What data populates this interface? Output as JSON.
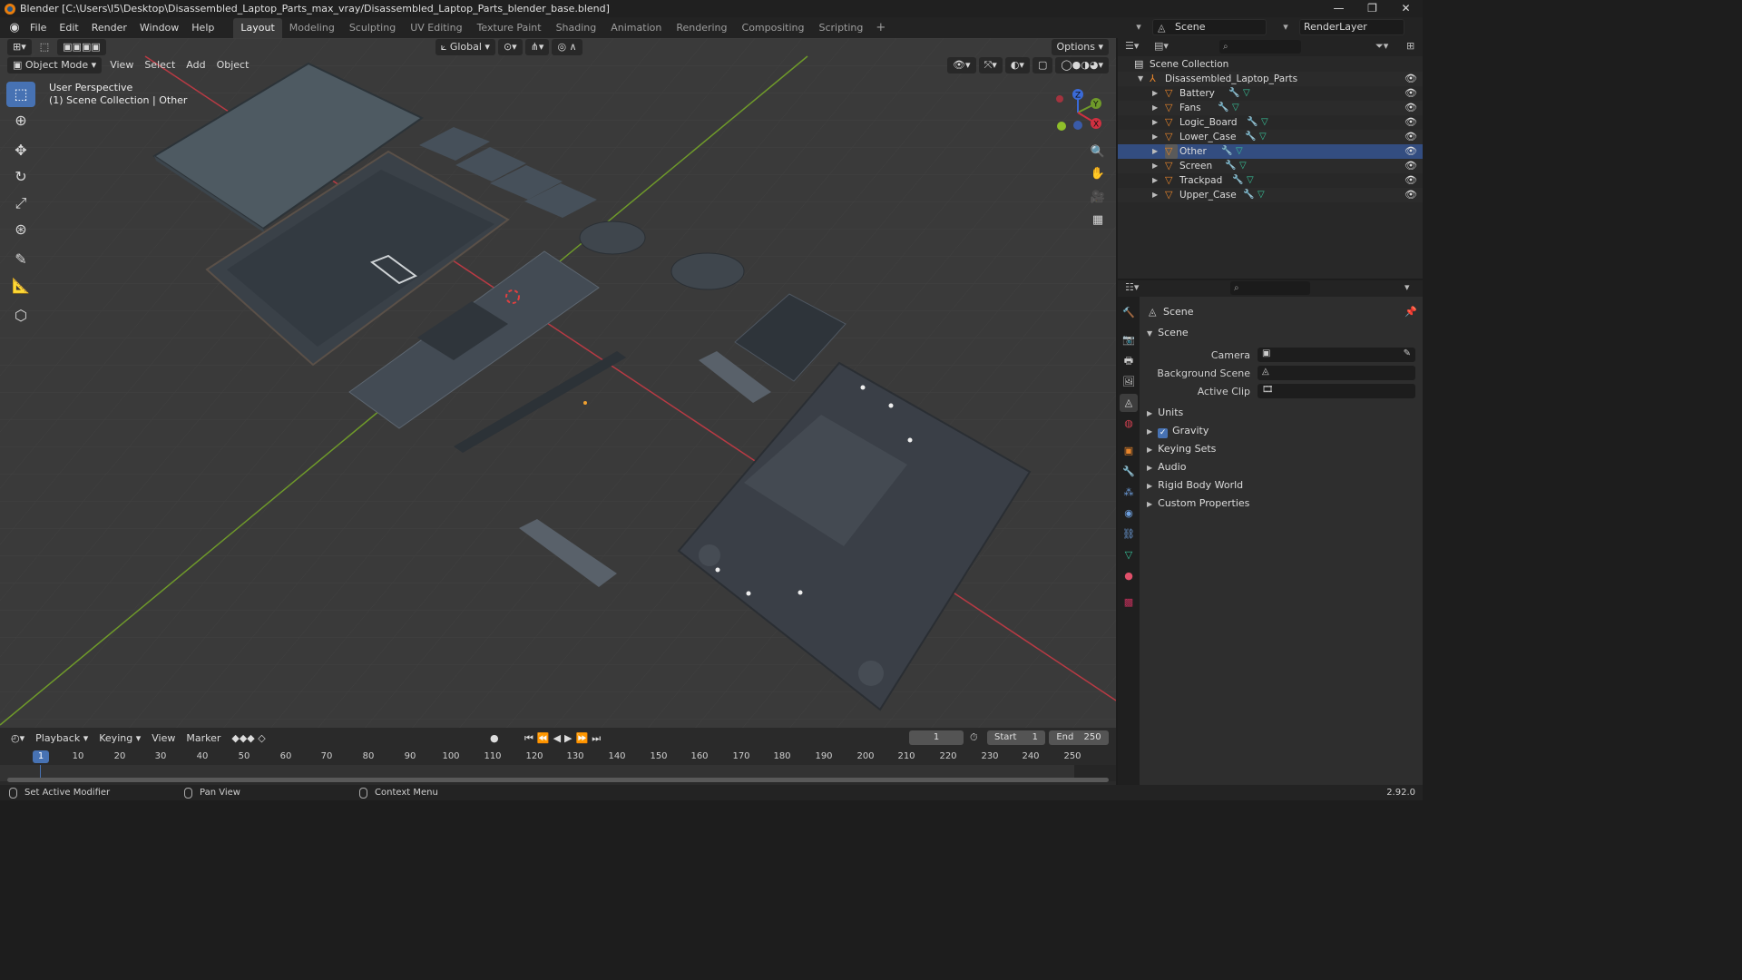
{
  "window": {
    "title": "Blender [C:\\Users\\I5\\Desktop\\Disassembled_Laptop_Parts_max_vray/Disassembled_Laptop_Parts_blender_base.blend]",
    "controls": [
      "—",
      "❐",
      "✕"
    ]
  },
  "menubar": {
    "menus": [
      "File",
      "Edit",
      "Render",
      "Window",
      "Help"
    ],
    "workspaces": [
      "Layout",
      "Modeling",
      "Sculpting",
      "UV Editing",
      "Texture Paint",
      "Shading",
      "Animation",
      "Rendering",
      "Compositing",
      "Scripting"
    ],
    "active_workspace": "Layout",
    "add_workspace": "+",
    "scene_name": "Scene",
    "view_layer": "RenderLayer"
  },
  "viewport": {
    "mode": "Object Mode",
    "menus": [
      "View",
      "Select",
      "Add",
      "Object"
    ],
    "orientation": "Global",
    "options": "Options",
    "overlay_line1": "User Perspective",
    "overlay_line2": "(1) Scene Collection | Other",
    "gizmo": {
      "x": "X",
      "y": "Y",
      "z": "Z"
    }
  },
  "outliner": {
    "root": "Scene Collection",
    "collection": "Disassembled_Laptop_Parts",
    "objects": [
      "Battery",
      "Fans",
      "Logic_Board",
      "Lower_Case",
      "Other",
      "Screen",
      "Trackpad",
      "Upper_Case"
    ],
    "selected": "Other"
  },
  "properties": {
    "title": "Scene",
    "panel_scene": "Scene",
    "camera_label": "Camera",
    "background_scene_label": "Background Scene",
    "active_clip_label": "Active Clip",
    "subpanels": [
      "Units",
      "Gravity",
      "Keying Sets",
      "Audio",
      "Rigid Body World",
      "Custom Properties"
    ],
    "gravity_checked": true
  },
  "timeline": {
    "menus": [
      "Playback",
      "Keying",
      "View",
      "Marker"
    ],
    "current_frame": "1",
    "start_label": "Start",
    "start_value": "1",
    "end_label": "End",
    "end_value": "250",
    "ruler": [
      "10",
      "20",
      "30",
      "40",
      "50",
      "60",
      "70",
      "80",
      "90",
      "100",
      "110",
      "120",
      "130",
      "140",
      "150",
      "160",
      "170",
      "180",
      "190",
      "200",
      "210",
      "220",
      "230",
      "240",
      "250"
    ],
    "ruler_current": "1"
  },
  "statusbar": {
    "hint1": "Set Active Modifier",
    "hint2": "Pan View",
    "hint3": "Context Menu",
    "version": "2.92.0"
  }
}
